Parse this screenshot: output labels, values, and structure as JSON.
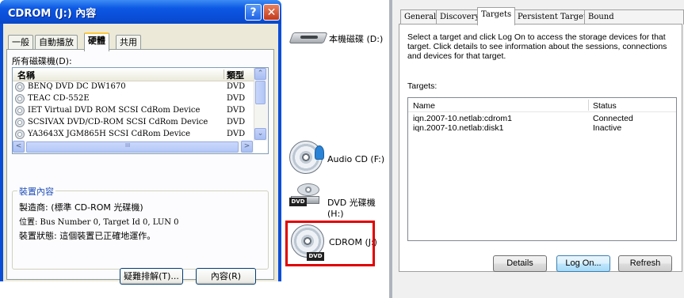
{
  "dialog": {
    "title": "CDROM (J:) 內容",
    "help_glyph": "?",
    "close_glyph": "✕",
    "tabs": [
      "一般",
      "自動播放",
      "硬體",
      "共用"
    ],
    "devices_label": "所有磁碟機(D):",
    "columns": {
      "name": "名稱",
      "type": "類型"
    },
    "devices": [
      {
        "name": "BENQ DVD DC DW1670",
        "type": "DVD"
      },
      {
        "name": "TEAC CD-552E",
        "type": "DVD"
      },
      {
        "name": "IET      Virtual DVD ROM  SCSI CdRom Device",
        "type": "DVD"
      },
      {
        "name": "SCSIVAX DVD/CD-ROM SCSI CdRom Device",
        "type": "DVD"
      },
      {
        "name": "YA3643X JGM865H SCSI CdRom Device",
        "type": "DVD"
      }
    ],
    "scroll_up": "⌃",
    "scroll_down": "⌄",
    "scroll_left": "<",
    "scroll_right": ">",
    "scroll_grip": "III",
    "group_title": "裝置內容",
    "manufacturer": "製造商: (標準 CD-ROM 光碟機)",
    "location": "位置: Bus Number 0, Target Id 0, LUN 0",
    "status": "裝置狀態: 這個裝置已正確地運作。",
    "troubleshoot_button": "疑難排解(T)...",
    "properties_button": "內容(R)"
  },
  "explorer": {
    "drives": [
      {
        "label": "本機磁碟 (D:)",
        "icon": "hard-drive-icon"
      },
      {
        "label": "Audio CD (F:)",
        "icon": "audio-cd-icon"
      },
      {
        "label": "DVD 光碟機 (H:)",
        "icon": "dvd-drive-icon"
      },
      {
        "label": "CDROM (J:)",
        "icon": "cdrom-drive-icon"
      }
    ],
    "dvd_tag": "DVD",
    "highlight_color": "#e00000"
  },
  "iscsi": {
    "tabs": [
      "General",
      "Discovery",
      "Targets",
      "Persistent Targets",
      "Bound Volumes/Devices"
    ],
    "description": "Select a target and click Log On to access the storage devices for that target. Click details to see information about the sessions, connections and devices for that target.",
    "targets_label": "Targets:",
    "columns": {
      "name": "Name",
      "status": "Status"
    },
    "targets": [
      {
        "name": "iqn.2007-10.netlab:cdrom1",
        "status": "Connected"
      },
      {
        "name": "iqn.2007-10.netlab:disk1",
        "status": "Inactive"
      }
    ],
    "buttons": {
      "details": "Details",
      "logon": "Log On...",
      "refresh": "Refresh"
    }
  }
}
